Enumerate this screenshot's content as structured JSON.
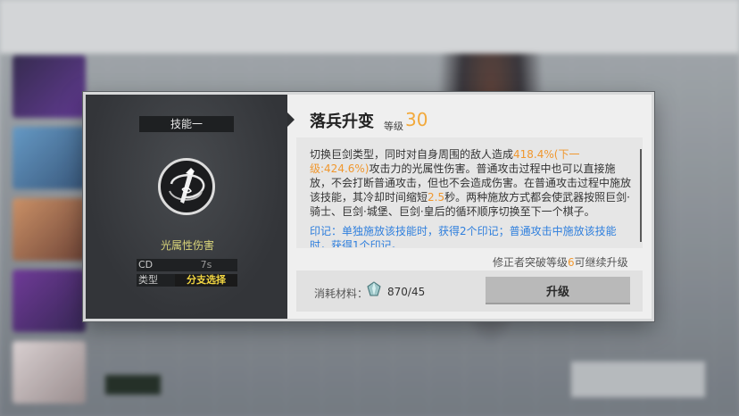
{
  "dialog": {
    "skill_tab": "技能一",
    "attribute": "光属性伤害",
    "stats": {
      "cd_key": "CD",
      "cd_value": "7s",
      "type_key": "类型",
      "type_value": "分支选择"
    },
    "skill_name": "落兵升变",
    "level_label": "等级",
    "level_value": "30",
    "description": {
      "part1": "切换巨剑类型，同时对自身周围的敌人造成",
      "damage": "418.4%(下一级:424.6%)",
      "part2": "攻击力的光属性伤害。普通攻击过程中也可以直接施放，不会打断普通攻击，但也不会造成伤害。在普通攻击过程中施放该技能，其冷却时间缩短",
      "cooldown_reduction": "2.5",
      "part3": "秒。两种施放方式都会使武器按照巨剑·骑士、巨剑·城堡、巨剑·皇后的循环顺序切换至下一个棋子。"
    },
    "note": "印记：单独施放该技能时，获得2个印记；普通攻击中施放该技能时，获得1个印记。",
    "requirement": {
      "before": "修正者突破等级",
      "level": "6",
      "after": "可继续升级"
    },
    "cost": {
      "label": "消耗材料：",
      "value": "870/45",
      "icon": "crystal-icon"
    },
    "upgrade_label": "升级"
  },
  "colors": {
    "level_accent": "#f2a93b",
    "highlight": "#f0972e",
    "note_blue": "#2f7fdd",
    "type_yellow": "#f1d541",
    "attribute_yellow": "#d9d47a"
  }
}
